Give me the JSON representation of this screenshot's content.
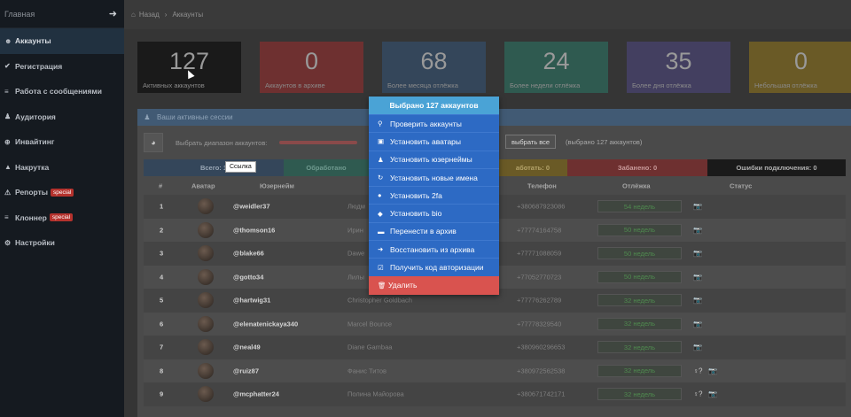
{
  "sidebar": {
    "header": "Главная",
    "items": [
      {
        "label": "Аккаунты",
        "icon": "users-icon",
        "glyph": "☻",
        "active": true
      },
      {
        "label": "Регистрация",
        "icon": "check-icon",
        "glyph": "✔"
      },
      {
        "label": "Работа с сообщениями",
        "icon": "list-icon",
        "glyph": "≡"
      },
      {
        "label": "Аудитория",
        "icon": "user-icon",
        "glyph": "♟"
      },
      {
        "label": "Инвайтинг",
        "icon": "plus-circle-icon",
        "glyph": "⊕"
      },
      {
        "label": "Накрутка",
        "icon": "thumbs-up-icon",
        "glyph": "▲"
      },
      {
        "label": "Репорты",
        "icon": "warning-icon",
        "glyph": "⚠",
        "badge": "special"
      },
      {
        "label": "Клоннер",
        "icon": "list-icon",
        "glyph": "≡",
        "badge": "special"
      },
      {
        "label": "Настройки",
        "icon": "gear-icon",
        "glyph": "⚙"
      }
    ]
  },
  "breadcrumb": {
    "home": "Назад",
    "current": "Аккаунты"
  },
  "stats": [
    {
      "value": "127",
      "label": "Активных аккаунтов",
      "color": "#1a1a1a"
    },
    {
      "value": "0",
      "label": "Аккаунтов в архиве",
      "color": "#6e3030"
    },
    {
      "value": "68",
      "label": "Более месяца отлёжка",
      "color": "#34465a"
    },
    {
      "value": "24",
      "label": "Более недели отлёжка",
      "color": "#2f5a50"
    },
    {
      "value": "35",
      "label": "Более дня отлёжка",
      "color": "#433f60"
    },
    {
      "value": "0",
      "label": "Небольшая отлёжка",
      "color": "#6a5a26"
    }
  ],
  "panel": {
    "title": "Ваши активные сессии",
    "range_label": "Выбрать диапазон аккаунтов:",
    "select_all": "выбрать все",
    "selected_count": "(выбрано 127 аккаунтов)"
  },
  "status_bar": {
    "total": "Всего: 1",
    "processed": "Обработано",
    "working": "аботать: 0",
    "banned": "Забанено: 0",
    "conn_errors": "Ошибки подключения: 0"
  },
  "table": {
    "headers": [
      "#",
      "Аватар",
      "Юзернейм",
      "Телефон",
      "Отлёжка",
      "Статус"
    ],
    "rows": [
      {
        "num": "1",
        "user": "@weidler37",
        "name": "Людм",
        "phone": "+380687923086",
        "age": "54 недель",
        "extra": ""
      },
      {
        "num": "2",
        "user": "@thomson16",
        "name": "Ирин",
        "phone": "+77774164758",
        "age": "50 недель",
        "extra": ""
      },
      {
        "num": "3",
        "user": "@blake66",
        "name": "Dawe",
        "phone": "+77771088059",
        "age": "50 недель",
        "extra": ""
      },
      {
        "num": "4",
        "user": "@gotto34",
        "name": "Лилы",
        "phone": "+77052770723",
        "age": "50 недель",
        "extra": ""
      },
      {
        "num": "5",
        "user": "@hartwig31",
        "name": "Christopher Goldbach",
        "phone": "+77776262789",
        "age": "32 недель",
        "extra": ""
      },
      {
        "num": "6",
        "user": "@elenatenickaya340",
        "name": "Marcel Bounce",
        "phone": "+77778329540",
        "age": "32 недель",
        "extra": ""
      },
      {
        "num": "7",
        "user": "@neal49",
        "name": "Diane Gambaa",
        "phone": "+380960296653",
        "age": "32 недель",
        "extra": ""
      },
      {
        "num": "8",
        "user": "@ruiz87",
        "name": "Фанис Титов",
        "phone": "+380972562538",
        "age": "32 недель",
        "extra": "♀?"
      },
      {
        "num": "9",
        "user": "@mcphatter24",
        "name": "Полина Майорова",
        "phone": "+380671742171",
        "age": "32 недель",
        "extra": "♀?"
      }
    ]
  },
  "context_menu": {
    "title": "Выбрано 127 аккаунтов",
    "items": [
      {
        "label": "Проверить аккаунты",
        "glyph": "⚲"
      },
      {
        "label": "Установить аватары",
        "glyph": "▣"
      },
      {
        "label": "Установить юзернеймы",
        "glyph": "♟"
      },
      {
        "label": "Установить новые имена",
        "glyph": "↻"
      },
      {
        "label": "Установить 2fa",
        "glyph": "●"
      },
      {
        "label": "Установить bio",
        "glyph": "◆"
      },
      {
        "label": "Перенести в архив",
        "glyph": "▬"
      },
      {
        "label": "Восстановить из архива",
        "glyph": "➜"
      },
      {
        "label": "Получить код авторизации",
        "glyph": "☑"
      }
    ],
    "delete": "Удалить"
  },
  "tooltip": "Ссылка"
}
